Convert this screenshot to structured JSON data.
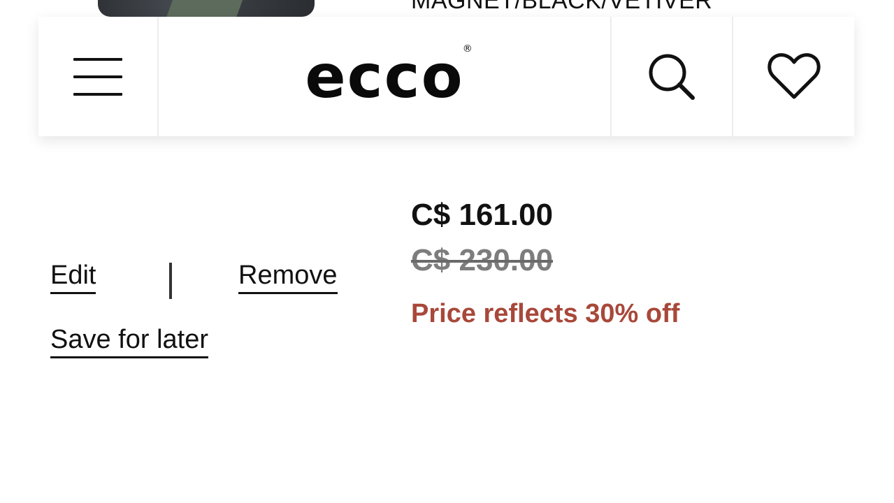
{
  "product": {
    "color_name": "MAGNET/BLACK/VETIVER"
  },
  "header": {
    "logo": "ecco",
    "logo_mark": "®",
    "icons": [
      "menu-icon",
      "search-icon",
      "heart-icon"
    ]
  },
  "pricing": {
    "current_price": "C$ 161.00",
    "original_price": "C$ 230.00",
    "discount_note": "Price reflects 30% off",
    "discount_color": "#a8483a"
  },
  "actions": {
    "edit_label": "Edit",
    "separator": "|",
    "remove_label": "Remove",
    "save_later_label": "Save for later"
  }
}
